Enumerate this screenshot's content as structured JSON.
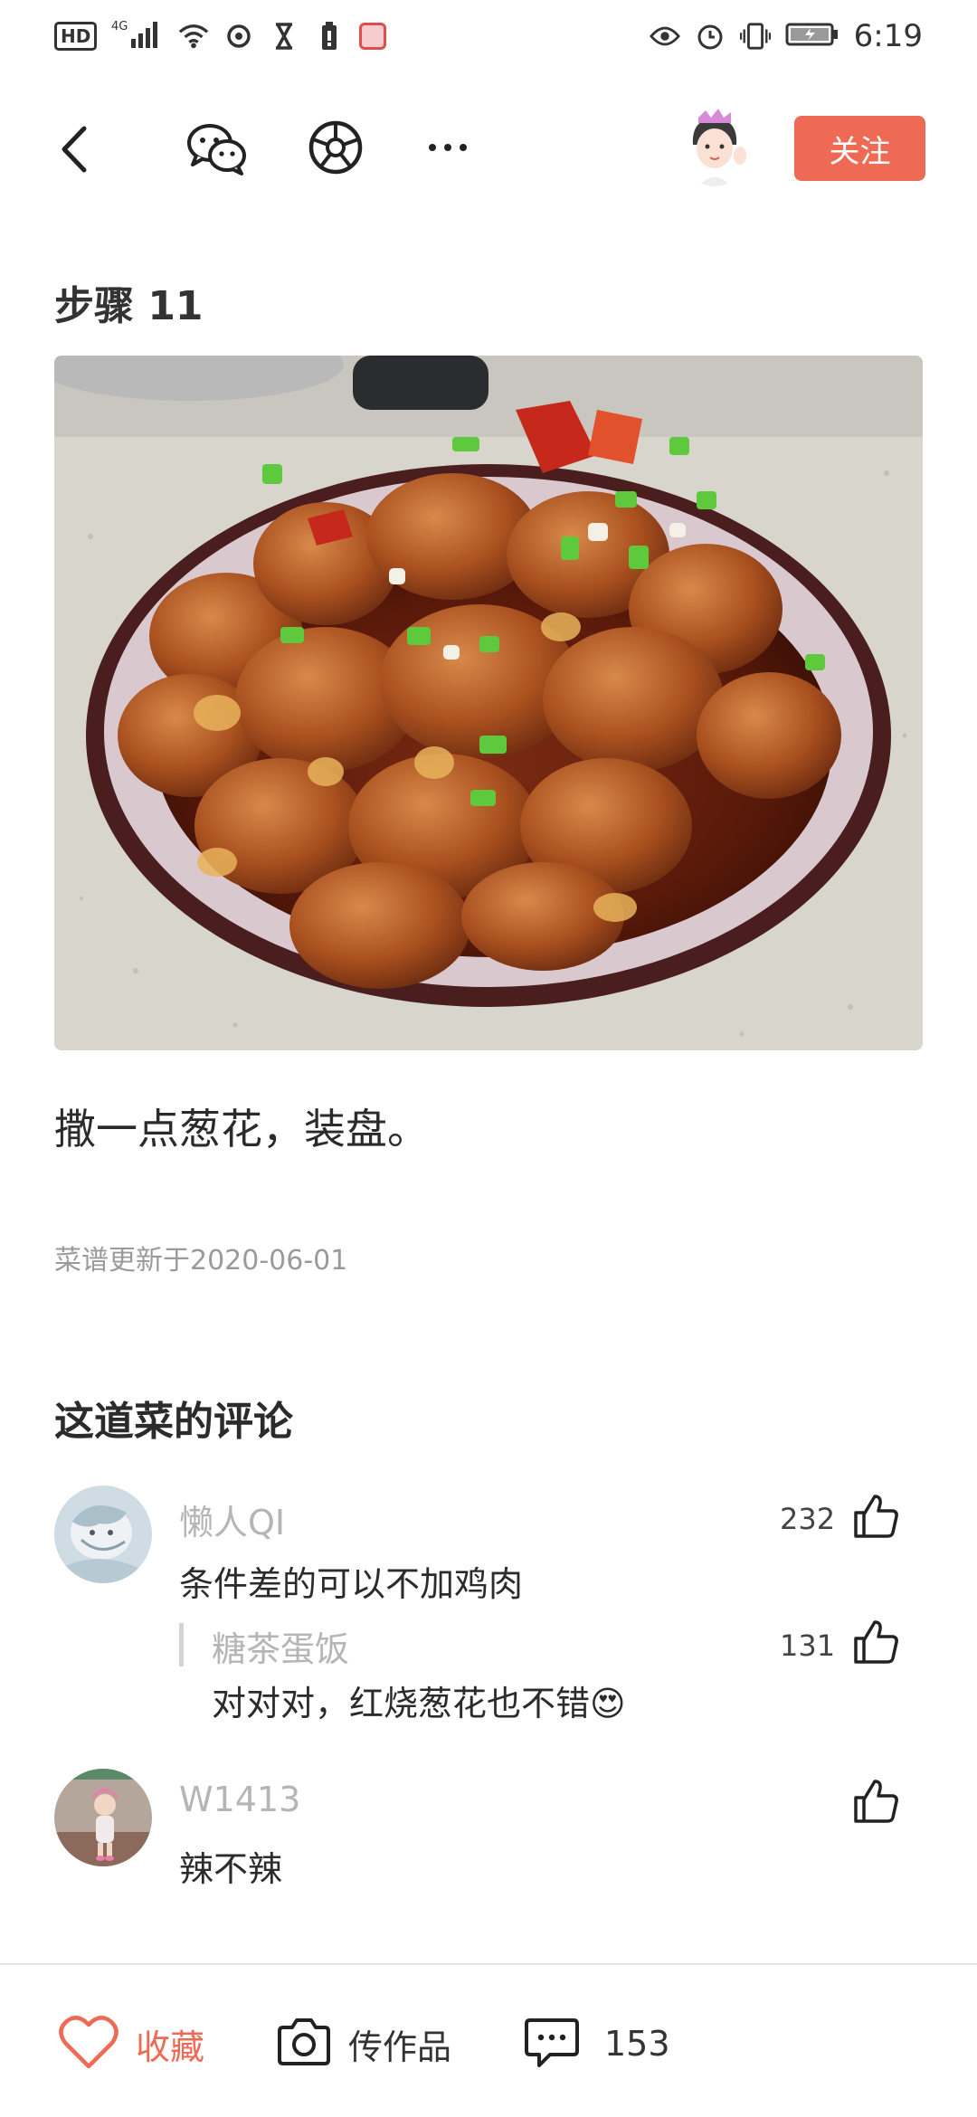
{
  "status_bar": {
    "network": "HD",
    "signal_label": "4G",
    "time": "6:19",
    "icons": [
      "hd-icon",
      "signal-icon",
      "wifi-icon",
      "sync-icon",
      "hourglass-icon",
      "battery-saver-icon",
      "app-notification-icon",
      "eye-icon",
      "alarm-icon",
      "vibrate-icon",
      "battery-icon"
    ]
  },
  "nav": {
    "follow_label": "关注",
    "icons": [
      "back-icon",
      "wechat-icon",
      "moments-icon",
      "more-icon"
    ]
  },
  "step": {
    "title": "步骤 11",
    "description": "撒一点葱花，装盘。"
  },
  "recipe_update": "菜谱更新于2020-06-01",
  "comments": {
    "title": "这道菜的评论",
    "items": [
      {
        "user": "懒人QI",
        "text": "条件差的可以不加鸡肉",
        "likes": "232",
        "reply": {
          "user": "糖茶蛋饭",
          "text": "对对对，红烧葱花也不错😍",
          "likes": "131"
        }
      },
      {
        "user": "W1413",
        "text": "辣不辣",
        "likes": ""
      }
    ]
  },
  "bottom_bar": {
    "favorite_label": "收藏",
    "upload_label": "传作品",
    "comment_count": "153"
  },
  "colors": {
    "accent": "#ef6a55",
    "muted": "#9a9a9a",
    "text": "#2b2b2b"
  }
}
